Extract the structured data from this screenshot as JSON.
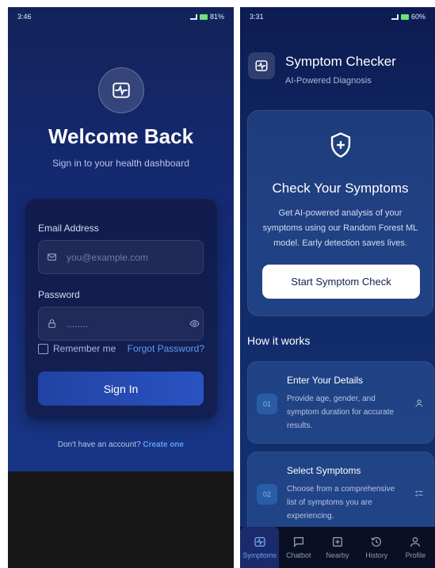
{
  "login": {
    "status_time": "3:46",
    "status_battery": "81%",
    "title": "Welcome Back",
    "subtitle": "Sign in to your health dashboard",
    "email_label": "Email Address",
    "email_placeholder": "you@example.com",
    "password_label": "Password",
    "password_value": "........",
    "remember_label": "Remember me",
    "forgot_label": "Forgot Password?",
    "signin_label": "Sign In",
    "signup_text": "Don't have an account?",
    "signup_link": "Create one"
  },
  "checker": {
    "status_time": "3:31",
    "status_battery": "60%",
    "app_title": "Symptom Checker",
    "app_subtitle": "AI-Powered Diagnosis",
    "hero_title": "Check Your Symptoms",
    "hero_text": "Get AI-powered analysis of your symptoms using our Random Forest ML model. Early detection saves lives.",
    "start_label": "Start Symptom Check",
    "how_title": "How it works",
    "steps": [
      {
        "num": "01",
        "title": "Enter Your Details",
        "text": "Provide age, gender, and symptom duration for accurate results.",
        "icon": "user-icon"
      },
      {
        "num": "02",
        "title": "Select Symptoms",
        "text": "Choose from a comprehensive list of symptoms you are experiencing.",
        "icon": "checklist-icon"
      }
    ],
    "nav": [
      {
        "label": "Symptoms",
        "icon": "pulse-icon",
        "active": true
      },
      {
        "label": "Chatbot",
        "icon": "chat-icon",
        "active": false
      },
      {
        "label": "Nearby",
        "icon": "plus-square-icon",
        "active": false
      },
      {
        "label": "History",
        "icon": "history-icon",
        "active": false
      },
      {
        "label": "Profile",
        "icon": "user-icon",
        "active": false
      }
    ]
  },
  "colors": {
    "accent": "#5b9cf5",
    "button": "#2a52c0",
    "card": "#121a44"
  }
}
